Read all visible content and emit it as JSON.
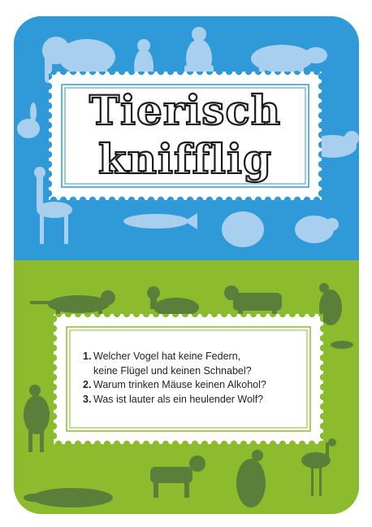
{
  "title": {
    "line1": "Tierisch",
    "line2": "knifflig"
  },
  "questions": [
    {
      "number": "1.",
      "line1": "Welcher Vogel hat keine Federn,",
      "line2": "keine Flügel und keinen Schnabel?"
    },
    {
      "number": "2.",
      "line1": "Warum trinken Mäuse keinen Alkohol?"
    },
    {
      "number": "3.",
      "line1": "Was ist lauter als ein heulender Wolf?"
    }
  ],
  "colors": {
    "top_background": "#2f9ad7",
    "bottom_background": "#8dbb2e",
    "top_silhouettes": "#a9cfee",
    "bottom_silhouettes": "#5a7f3a"
  },
  "icons": [
    "elephant-icon",
    "penguin-icon",
    "gorilla-icon",
    "pig-icon",
    "rabbit-icon",
    "tiger-icon",
    "giraffe-icon",
    "fish-icon",
    "hippo-icon",
    "cat-icon",
    "duck-icon",
    "cow-icon",
    "bird-icon",
    "deer-icon",
    "lizard-icon",
    "platypus-icon",
    "dog-icon",
    "vulture-icon",
    "heron-icon"
  ]
}
